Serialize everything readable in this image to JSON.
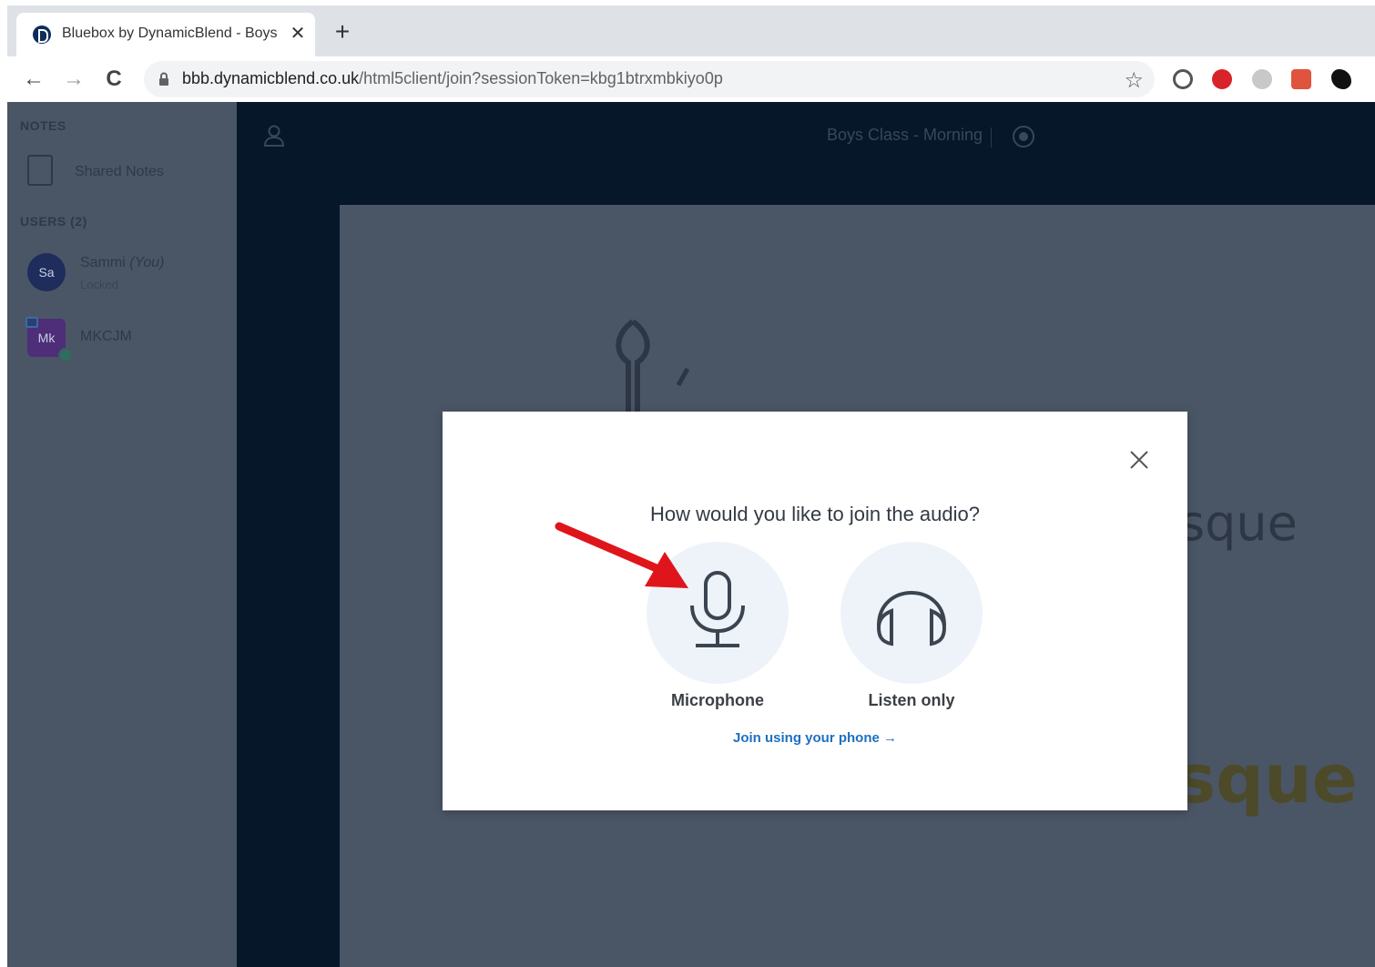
{
  "browser": {
    "tab_title": "Bluebox by DynamicBlend - Boys Class - Morning",
    "tab_close": "✕",
    "new_tab": "+",
    "url_host": "bbb.dynamicblend.co.uk",
    "url_path": "/html5client/join?sessionToken=kbg1btrxmbkiyo0p",
    "back": "←",
    "forward": "→",
    "reload": "C",
    "star": "☆"
  },
  "sidebar": {
    "notes_heading": "NOTES",
    "shared_notes": "Shared Notes",
    "users_heading": "USERS (2)",
    "users": [
      {
        "initials": "Sa",
        "name": "Sammi",
        "you": "(You)",
        "status": "Locked"
      },
      {
        "initials": "Mk",
        "name": "MKCJM"
      }
    ]
  },
  "header": {
    "meeting_title": "Boys Class - Morning"
  },
  "slide": {
    "text_1": "sque",
    "text_2": "sque"
  },
  "modal": {
    "title": "How would you like to join the audio?",
    "close": "close",
    "options": [
      {
        "label": "Microphone",
        "icon": "microphone-icon"
      },
      {
        "label": "Listen only",
        "icon": "headphones-icon"
      }
    ],
    "phone_link": "Join using your phone →"
  },
  "colors": {
    "sidebar_bg": "#4a5666",
    "header_bg": "#06172a",
    "modal_link": "#1f6fc1",
    "annotation_arrow": "#e0151b"
  }
}
